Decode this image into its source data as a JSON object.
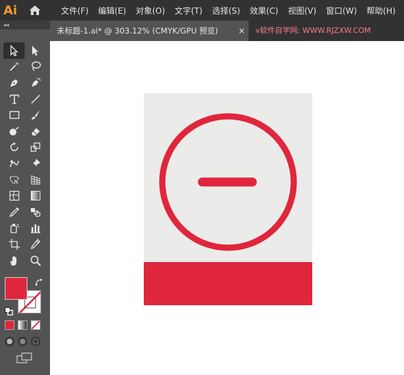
{
  "app": {
    "logo": "Ai",
    "home_icon": "home-icon"
  },
  "menu": {
    "items": [
      "文件(F)",
      "编辑(E)",
      "对象(O)",
      "文字(T)",
      "选择(S)",
      "效果(C)",
      "视图(V)",
      "窗口(W)",
      "帮助(H)"
    ]
  },
  "toolbar": {
    "collapse_label": "◂◂",
    "tools": [
      "selection-tool",
      "direct-selection-tool",
      "magic-wand-tool",
      "lasso-tool",
      "pen-tool",
      "curvature-tool",
      "type-tool",
      "line-segment-tool",
      "rectangle-tool",
      "paintbrush-tool",
      "shaper-tool",
      "eraser-tool",
      "rotate-tool",
      "scale-tool",
      "puppet-warp-tool",
      "pin-tool",
      "free-transform-tool",
      "perspective-grid-tool",
      "mesh-tool",
      "gradient-tool",
      "eyedropper-tool",
      "blend-tool",
      "symbol-sprayer-tool",
      "column-graph-tool",
      "artboard-tool",
      "slice-tool",
      "hand-tool",
      "zoom-tool"
    ],
    "active_tool": "selection-tool",
    "fill_color": "#e0263c",
    "stroke_color": "none"
  },
  "document": {
    "tab_title": "未标题-1.ai* @ 303.12% (CMYK/GPU 预览)",
    "close_glyph": "×",
    "watermark": "v软件自学网: WWW.RJZXW.COM"
  },
  "artwork": {
    "background_color": "#ebebea",
    "accent_color": "#e0263c"
  }
}
